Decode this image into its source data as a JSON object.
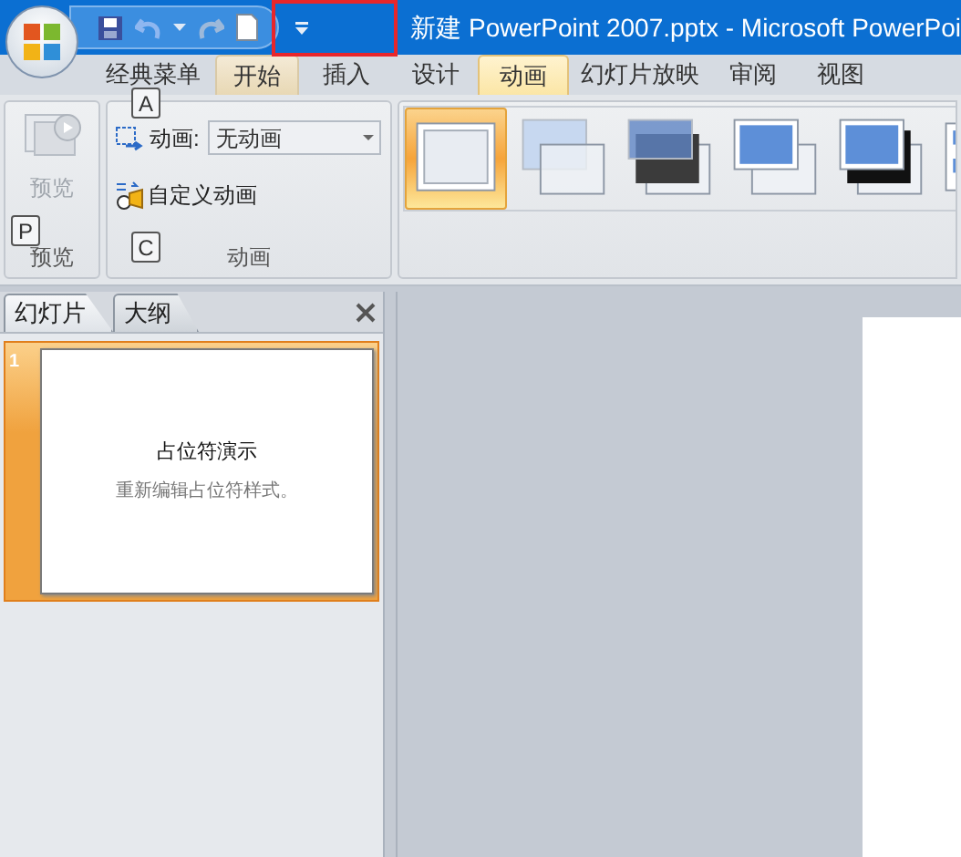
{
  "window": {
    "title": "新建 PowerPoint 2007.pptx - Microsoft PowerPoi"
  },
  "annotations": [
    {
      "kind": "highlight-box",
      "color": "#e8262b"
    }
  ],
  "tabs": [
    {
      "label": "经典菜单",
      "selected": false,
      "highlighted": false
    },
    {
      "label": "开始",
      "selected": false,
      "highlighted": true
    },
    {
      "label": "插入",
      "selected": false,
      "highlighted": false
    },
    {
      "label": "设计",
      "selected": false,
      "highlighted": false
    },
    {
      "label": "动画",
      "selected": true,
      "highlighted": false
    },
    {
      "label": "幻灯片放映",
      "selected": false,
      "highlighted": false
    },
    {
      "label": "审阅",
      "selected": false,
      "highlighted": false
    },
    {
      "label": "视图",
      "selected": false,
      "highlighted": false
    }
  ],
  "keytips": {
    "animation": "A",
    "preview": "P",
    "custom": "C"
  },
  "preview_group": {
    "button_label": "预览",
    "group_label": "预览",
    "disabled": true
  },
  "animation_group": {
    "animate_label": "动画:",
    "animate_value": "无动画",
    "custom_label": "自定义动画",
    "group_label": "动画"
  },
  "transitions": [
    {
      "kind": "none",
      "selected": true
    },
    {
      "kind": "fade",
      "selected": false
    },
    {
      "kind": "fade-dark",
      "selected": false
    },
    {
      "kind": "push",
      "selected": false
    },
    {
      "kind": "push-dark",
      "selected": false
    },
    {
      "kind": "checker",
      "selected": false
    }
  ],
  "slides_pane": {
    "tabs": [
      {
        "label": "幻灯片",
        "selected": true
      },
      {
        "label": "大纲",
        "selected": false
      }
    ],
    "slides": [
      {
        "number": "1",
        "selected": true,
        "title": "占位符演示",
        "subtitle": "重新编辑占位符样式。"
      }
    ]
  }
}
